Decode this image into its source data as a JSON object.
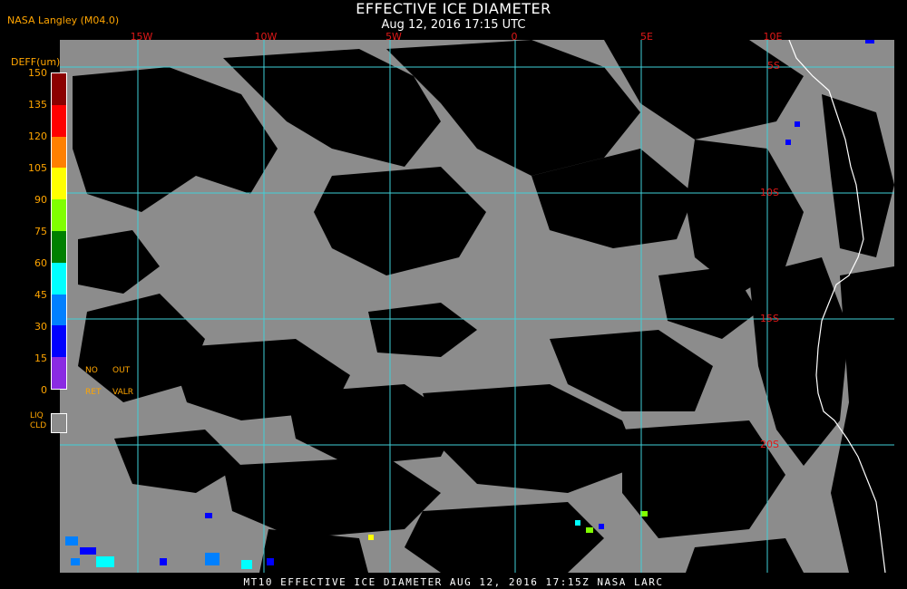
{
  "header": {
    "provider": "NASA Langley (M04.0)",
    "title": "EFFECTIVE ICE DIAMETER",
    "subtitle": "Aug 12, 2016 17:15 UTC"
  },
  "map": {
    "longitude_labels": [
      "15W",
      "10W",
      "5W",
      "0",
      "5E",
      "10E"
    ],
    "latitude_labels": [
      "5S",
      "10S",
      "15S",
      "20S"
    ],
    "colors": {
      "cloud": "#8c8c8c",
      "clear": "#000000",
      "grid": "#40d0d8",
      "coastline": "#ffffff",
      "label": "#e01818"
    }
  },
  "legend": {
    "unit": "DEFF(um)",
    "ticks": [
      "150",
      "135",
      "120",
      "105",
      "90",
      "75",
      "60",
      "45",
      "30",
      "15",
      "0"
    ],
    "colors": [
      "#8b0000",
      "#ff0000",
      "#ff8000",
      "#ffff00",
      "#80ff00",
      "#008000",
      "#00ffff",
      "#0080ff",
      "#0000ff",
      "#8a2be2"
    ],
    "no_ret_line1": "NO",
    "no_ret_line2": "RET",
    "out_valr_line1": "OUT",
    "out_valr_line2": "VALR",
    "liq_cld_line1": "LIQ",
    "liq_cld_line2": "CLD"
  },
  "footer": "MT10  EFFECTIVE ICE DIAMETER   AUG 12, 2016 17:15Z   NASA LARC"
}
